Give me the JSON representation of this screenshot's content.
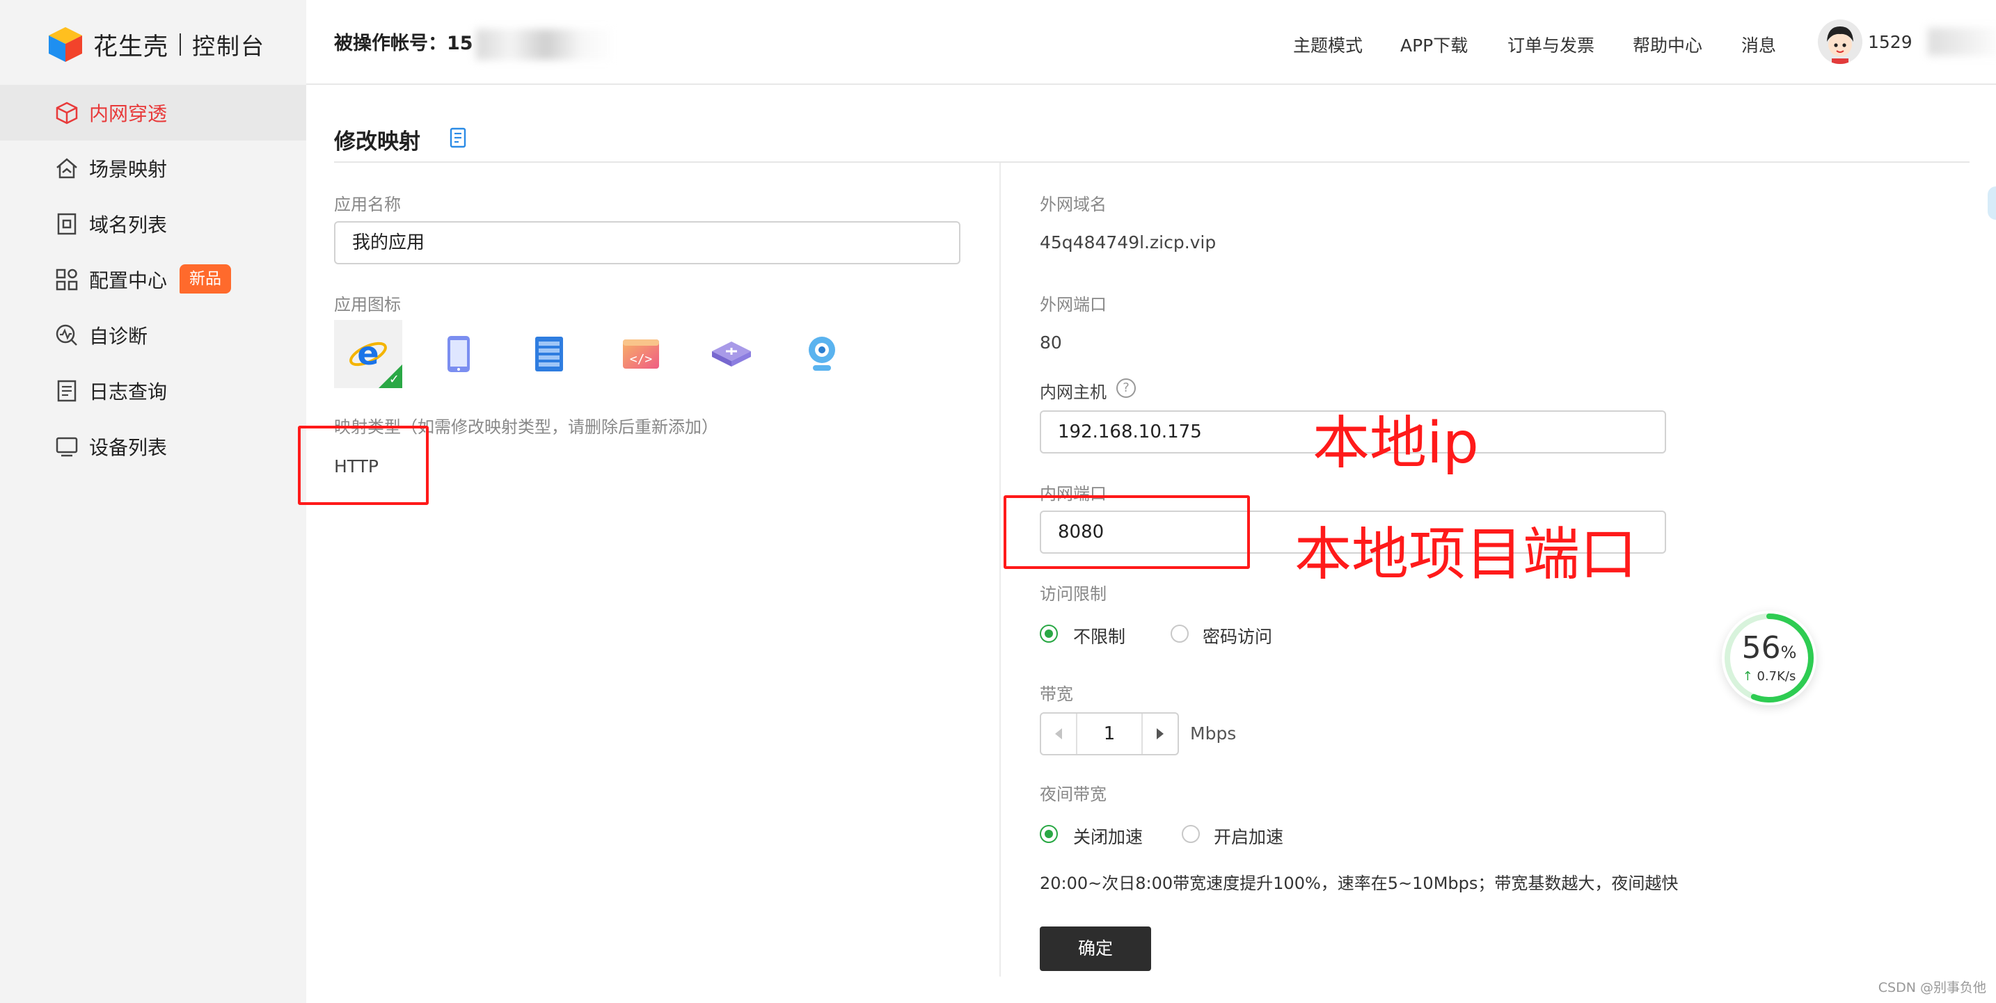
{
  "app": {
    "brand": "花生壳",
    "console": "控制台"
  },
  "sidebar": {
    "items": [
      {
        "label": "内网穿透",
        "icon": "cube-icon",
        "active": true
      },
      {
        "label": "场景映射",
        "icon": "house-icon"
      },
      {
        "label": "域名列表",
        "icon": "domain-icon"
      },
      {
        "label": "配置中心",
        "icon": "grid-icon",
        "badge": "新品"
      },
      {
        "label": "自诊断",
        "icon": "diagnose-icon"
      },
      {
        "label": "日志查询",
        "icon": "log-icon"
      },
      {
        "label": "设备列表",
        "icon": "monitor-icon"
      }
    ]
  },
  "header": {
    "account_label": "被操作帐号：15",
    "nav": [
      "主题模式",
      "APP下载",
      "订单与发票",
      "帮助中心",
      "消息"
    ],
    "username": "1529"
  },
  "page": {
    "title": "修改映射"
  },
  "left": {
    "app_name_label": "应用名称",
    "app_name_value": "我的应用",
    "app_icon_label": "应用图标",
    "icons": [
      "ie-icon",
      "tablet-icon",
      "server-icon",
      "code-icon",
      "router-icon",
      "webcam-icon"
    ],
    "map_type_label": "映射类型（如需修改映射类型，请删除后重新添加）",
    "map_type_value": "HTTP"
  },
  "right": {
    "domain_label": "外网域名",
    "domain_value": "45q484749l.zicp.vip",
    "ext_port_label": "外网端口",
    "ext_port_value": "80",
    "int_host_label": "内网主机",
    "int_host_help": "?",
    "int_host_value": "192.168.10.175",
    "int_port_label": "内网端口",
    "int_port_value": "8080",
    "access_label": "访问限制",
    "access_options": [
      "不限制",
      "密码访问"
    ],
    "bandwidth_label": "带宽",
    "bandwidth_value": "1",
    "bandwidth_unit": "Mbps",
    "night_label": "夜间带宽",
    "night_options": [
      "关闭加速",
      "开启加速"
    ],
    "night_desc": "20:00~次日8:00带宽速度提升100%，速率在5~10Mbps；带宽基数越大，夜间越快",
    "confirm_label": "确定"
  },
  "annotations": {
    "ip_note": "本地ip",
    "port_note": "本地项目端口"
  },
  "speed_widget": {
    "percent": "56",
    "percent_unit": "%",
    "rate": "0.7K/s",
    "progress": 0.56
  },
  "watermark": "CSDN @别事负他",
  "colors": {
    "accent_red": "#e83a3a",
    "green": "#2aa845",
    "annotation_red": "#ff1a1a",
    "badge_orange": "#ff6a2c"
  }
}
